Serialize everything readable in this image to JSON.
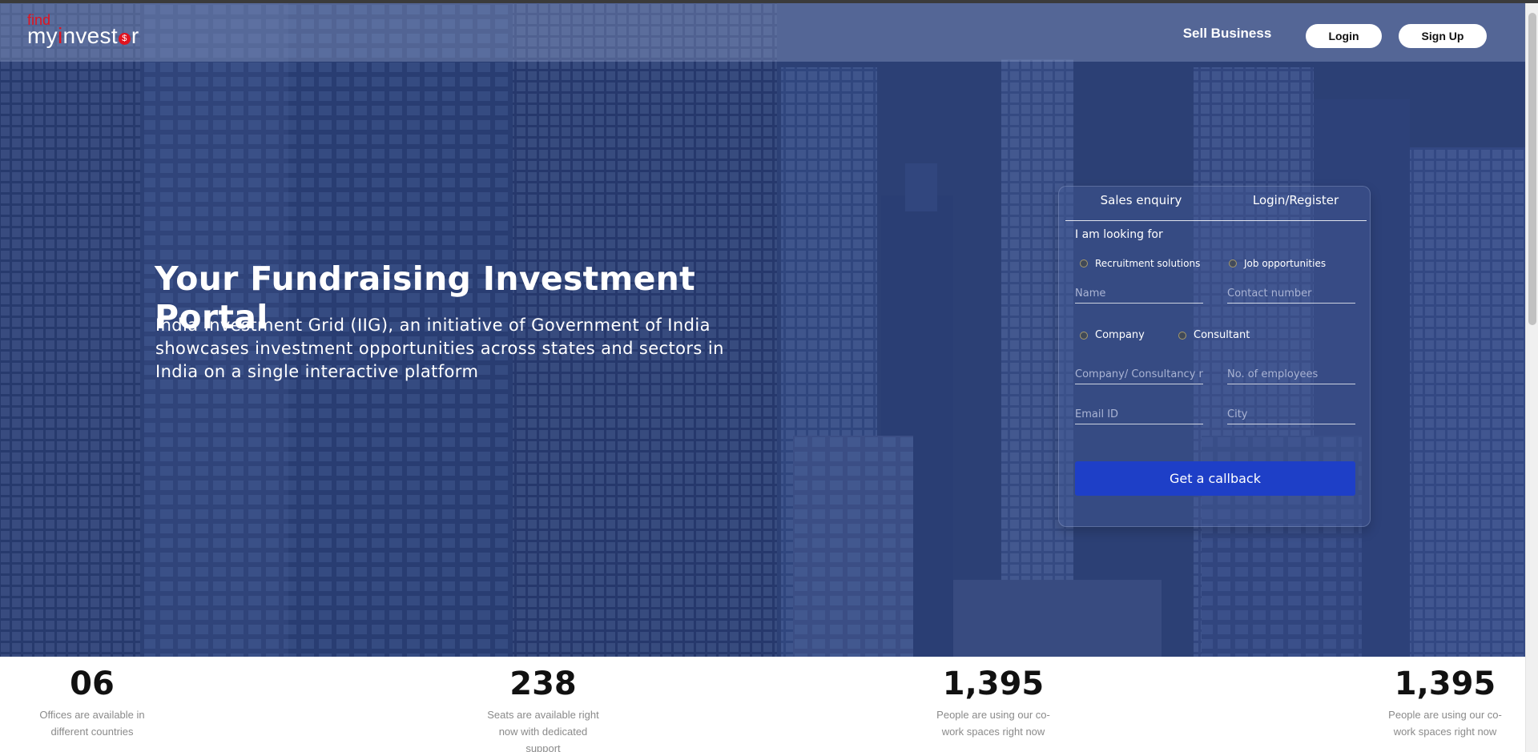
{
  "navbar": {
    "logo_find": "find",
    "logo_my": "my",
    "logo_i": "i",
    "logo_nvest": "nvest",
    "logo_coin": "$",
    "logo_r": "r",
    "sell_business": "Sell Business",
    "login": "Login",
    "signup": "Sign Up"
  },
  "hero": {
    "title": "Your Fundraising Investment Portal",
    "description": "India Investment Grid (IIG), an initiative of Government of India showcases investment opportunities across states and sectors in India on a single interactive platform"
  },
  "form": {
    "tabs": [
      "Sales enquiry",
      "Login/Register"
    ],
    "looking_for_label": "I am looking for",
    "looking_options": [
      "Recruitment solutions",
      "Job opportunities"
    ],
    "name_placeholder": "Name",
    "contact_placeholder": "Contact number",
    "type_options": [
      "Company",
      "Consultant"
    ],
    "company_placeholder": "Company/ Consultancy name",
    "employees_placeholder": "No. of employees",
    "email_placeholder": "Email ID",
    "city_placeholder": "City",
    "submit_label": "Get a callback"
  },
  "stats": [
    {
      "value": "06",
      "label": "Offices are available in different countries"
    },
    {
      "value": "238",
      "label": "Seats are available right now with dedicated support"
    },
    {
      "value": "1,395",
      "label": "People are using our co-work spaces right now"
    },
    {
      "value": "1,395",
      "label": "People are using our co-work spaces right now"
    }
  ],
  "colors": {
    "accent_red": "#e0131f",
    "button_blue": "#1e3fc7",
    "hero_blue": "#324776"
  },
  "icons": {
    "radio": "radio-circle-icon",
    "logo_coin": "dollar-coin-icon"
  }
}
